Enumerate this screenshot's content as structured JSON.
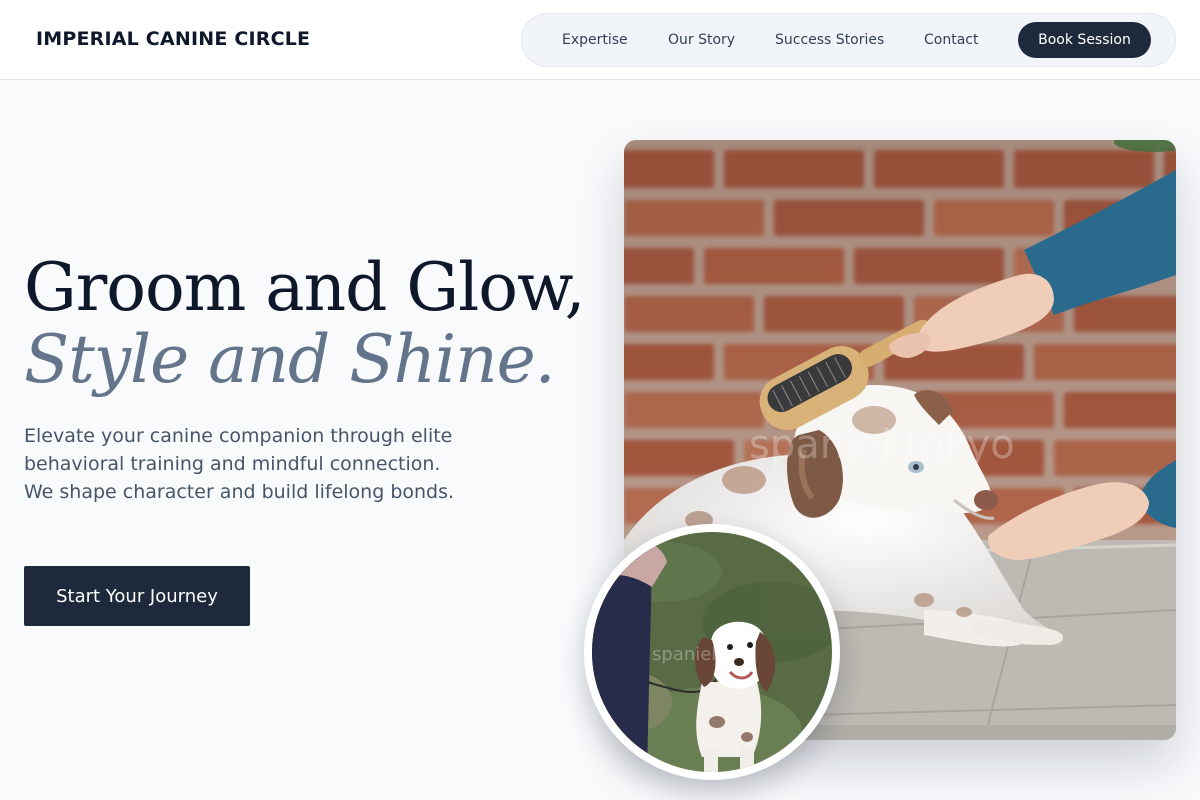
{
  "header": {
    "brand": "IMPERIAL CANINE CIRCLE",
    "nav": {
      "items": [
        "Expertise",
        "Our Story",
        "Success Stories",
        "Contact"
      ],
      "cta_label": "Book Session"
    }
  },
  "hero": {
    "headline_line1": "Groom and Glow,",
    "headline_line2": "Style and Shine.",
    "lead": "Elevate your canine companion through elite behavioral training and mindful connection. We shape character and build lifelong bonds.",
    "cta_label": "Start Your Journey"
  },
  "images": {
    "main": {
      "subject": "puppy-being-brushed-photo",
      "watermark": "spaniel tokyo"
    },
    "circle": {
      "subject": "spaniel-on-grass-photo",
      "watermark": "spaniel"
    }
  },
  "colors": {
    "primary": "#1e293b",
    "accent_text": "#64748b",
    "background": "#f8fafc"
  }
}
